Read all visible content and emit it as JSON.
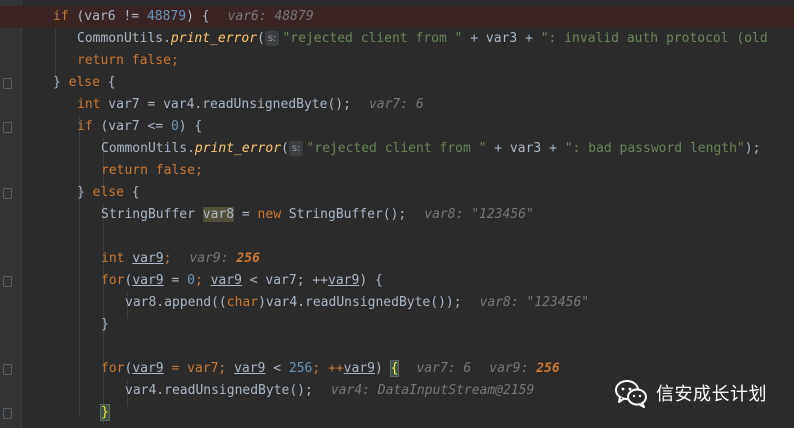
{
  "editor": {
    "lines": [
      {
        "type": "l1",
        "kw_if": "if",
        "p1": " (var6 != ",
        "num": "48879",
        "p2": ") {",
        "hint": "var6: 48879"
      },
      {
        "type": "l2",
        "cls": "CommonUtils.",
        "method": "print_error",
        "open": "(",
        "badge": "s:",
        "str1": "\"rejected client from \"",
        "p1": " + var3 + ",
        "str2": "\": invalid auth protocol (old"
      },
      {
        "type": "l3",
        "kw_return": "return",
        "kw_false": "false",
        ";": ";"
      },
      {
        "type": "l4",
        "close": "}",
        "kw_else": "else",
        "open": " {"
      },
      {
        "type": "l5",
        "kw_int": "int",
        "p1": " var7 = var4.readUnsignedByte();",
        "hint": "var7: 6"
      },
      {
        "type": "l6",
        "kw_if": "if",
        "p1": " (var7 <= ",
        "num": "0",
        "p2": ") {"
      },
      {
        "type": "l7",
        "cls": "CommonUtils.",
        "method": "print_error",
        "open": "(",
        "badge": "s:",
        "str1": "\"rejected client from \"",
        "p1": " + var3 + ",
        "str2": "\": bad password length\"",
        "p2": ");"
      },
      {
        "type": "l8",
        "kw_return": "return",
        "kw_false": "false",
        ";": ";"
      },
      {
        "type": "l9",
        "close": "}",
        "kw_else": "else",
        "open": " {"
      },
      {
        "type": "l10",
        "p1": "StringBuffer ",
        "var": "var8",
        "p2": " = ",
        "kw_new": "new",
        "p3": " StringBuffer();",
        "hint": "var8: \"123456\""
      },
      {
        "type": "l11",
        "kw_int": "int",
        "var": "var9",
        "p1": ";",
        "hint_name": "var9: ",
        "hint_num": "256"
      },
      {
        "type": "l12",
        "kw_for": "for",
        "p1": "(",
        "v1": "var9",
        "p2": " = ",
        "num": "0",
        "p3": "; ",
        "v2": "var9",
        "p4": " < var7; ++",
        "v3": "var9",
        "p5": ") {"
      },
      {
        "type": "l13",
        "p1": "var8.append((",
        "kw_char": "char",
        "p2": ")var4.readUnsignedByte());",
        "hint": "var8: \"123456\""
      },
      {
        "type": "l14",
        "close": "}"
      },
      {
        "type": "l15",
        "kw_for": "for",
        "p1": "(",
        "v1": "var9",
        "p2": " = var7; ",
        "v2": "var9",
        "p3": " < ",
        "num": "256",
        "p4": "; ++",
        "v3": "var9",
        "p5": ") ",
        "brace": "{",
        "hint1": "var7: 6",
        "hint2_name": "var9: ",
        "hint2_num": "256"
      },
      {
        "type": "l16",
        "p1": "var4.readUnsignedByte();",
        "hint": "var4: DataInputStream@2159"
      },
      {
        "type": "l17",
        "brace": "}"
      }
    ]
  },
  "watermark": {
    "text": "信安成长计划",
    "icon": "wechat-icon"
  },
  "colors": {
    "background": "#2b2b2b",
    "keyword": "#cc7832",
    "number": "#6897bb",
    "string": "#6a8759",
    "method": "#ffc66d",
    "breakpoint_line": "#3a2323"
  }
}
